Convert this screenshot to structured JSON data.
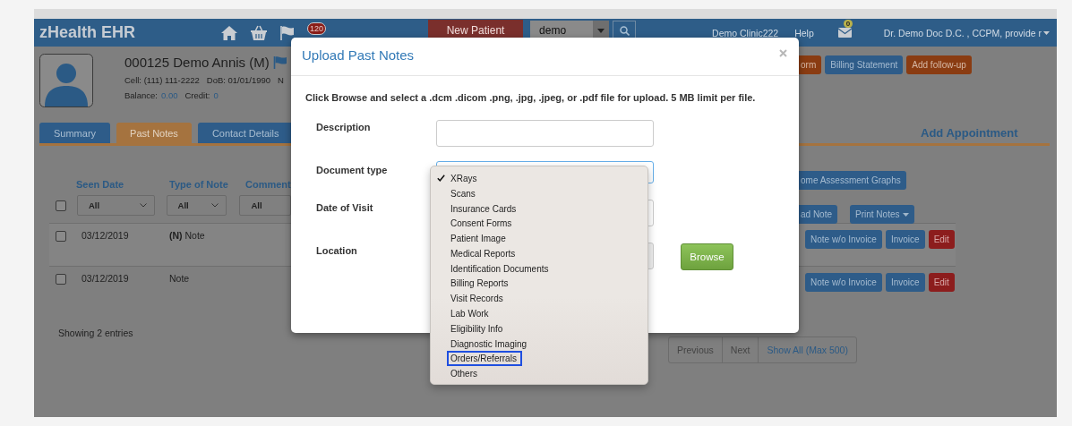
{
  "header": {
    "brand": "zHealth EHR",
    "notification_badge": "120",
    "new_patient": "New Patient",
    "search_value": "demo",
    "clinic": "Demo Clinic222",
    "help": "Help",
    "mail_badge": "0",
    "user": "Dr. Demo Doc D.C. , CCPM, provide r"
  },
  "patient": {
    "name": "000125 Demo Annis (M)",
    "details": [
      "Cell: (111) 111-2222",
      "DoB: 01/01/1990",
      "N"
    ],
    "balance_label": "Balance:",
    "balance": "0.00",
    "credit_label": "Credit:",
    "credit": "0"
  },
  "action_buttons": [
    {
      "label": "orm",
      "kind": "warning"
    },
    {
      "label": "Billing Statement",
      "kind": "primary"
    },
    {
      "label": "Add follow-up",
      "kind": "warning"
    }
  ],
  "tabs": [
    {
      "label": "Summary",
      "selected": false
    },
    {
      "label": "Past Notes",
      "selected": true
    },
    {
      "label": "Contact Details",
      "selected": false
    }
  ],
  "add_appointment": "Add Appointment",
  "toolbar": [
    {
      "label": "ome Assessment Graphs",
      "dropdown": false
    },
    {
      "label": "ad Note",
      "dropdown": false
    },
    {
      "label": "Print Notes",
      "dropdown": true
    }
  ],
  "table": {
    "select_all_checked": false,
    "columns": [
      {
        "label": "Seen Date",
        "filter": "All"
      },
      {
        "label": "Type of Note",
        "filter": "All"
      },
      {
        "label": "Comment",
        "filter": "All"
      }
    ],
    "rows": [
      {
        "checked": false,
        "seen_date": "03/12/2019",
        "type": "**(N)** Note",
        "actions": [
          {
            "label": "Note w/o Invoice",
            "kind": "primary"
          },
          {
            "label": "Invoice",
            "kind": "primary"
          },
          {
            "label": "Edit",
            "kind": "danger"
          }
        ]
      },
      {
        "checked": false,
        "seen_date": "03/12/2019",
        "type": "Note",
        "actions": [
          {
            "label": "Note w/o Invoice",
            "kind": "primary"
          },
          {
            "label": "Invoice",
            "kind": "primary"
          },
          {
            "label": "Edit",
            "kind": "danger"
          }
        ]
      }
    ]
  },
  "footer": {
    "info": "Showing 2 entries",
    "pagination": [
      {
        "label": "Previous",
        "disabled": true
      },
      {
        "label": "Next",
        "disabled": true
      },
      {
        "label": "Show All (Max 500)",
        "disabled": false
      }
    ]
  },
  "modal": {
    "title": "Upload Past Notes",
    "instruction": "Click Browse and select a .dcm .dicom .png, .jpg, .jpeg, or .pdf file for upload. 5 MB limit per file.",
    "fields": [
      {
        "label": "Description",
        "kind": "text"
      },
      {
        "label": "Document type",
        "kind": "select"
      },
      {
        "label": "Date of Visit",
        "kind": "date"
      },
      {
        "label": "Location",
        "kind": "file"
      }
    ],
    "browse": "Browse"
  },
  "dropdown": {
    "options": [
      {
        "label": "XRays",
        "selected": true,
        "focused": false
      },
      {
        "label": "Scans",
        "selected": false,
        "focused": false
      },
      {
        "label": "Insurance Cards",
        "selected": false,
        "focused": false
      },
      {
        "label": "Consent Forms",
        "selected": false,
        "focused": false
      },
      {
        "label": "Patient Image",
        "selected": false,
        "focused": false
      },
      {
        "label": "Medical Reports",
        "selected": false,
        "focused": false
      },
      {
        "label": "Identification Documents",
        "selected": false,
        "focused": false
      },
      {
        "label": "Billing Reports",
        "selected": false,
        "focused": false
      },
      {
        "label": "Visit Records",
        "selected": false,
        "focused": false
      },
      {
        "label": "Lab Work",
        "selected": false,
        "focused": false
      },
      {
        "label": "Eligibility Info",
        "selected": false,
        "focused": false
      },
      {
        "label": "Diagnostic Imaging",
        "selected": false,
        "focused": false
      },
      {
        "label": "Orders/Referrals",
        "selected": false,
        "focused": true
      },
      {
        "label": "Others",
        "selected": false,
        "focused": false
      }
    ]
  }
}
